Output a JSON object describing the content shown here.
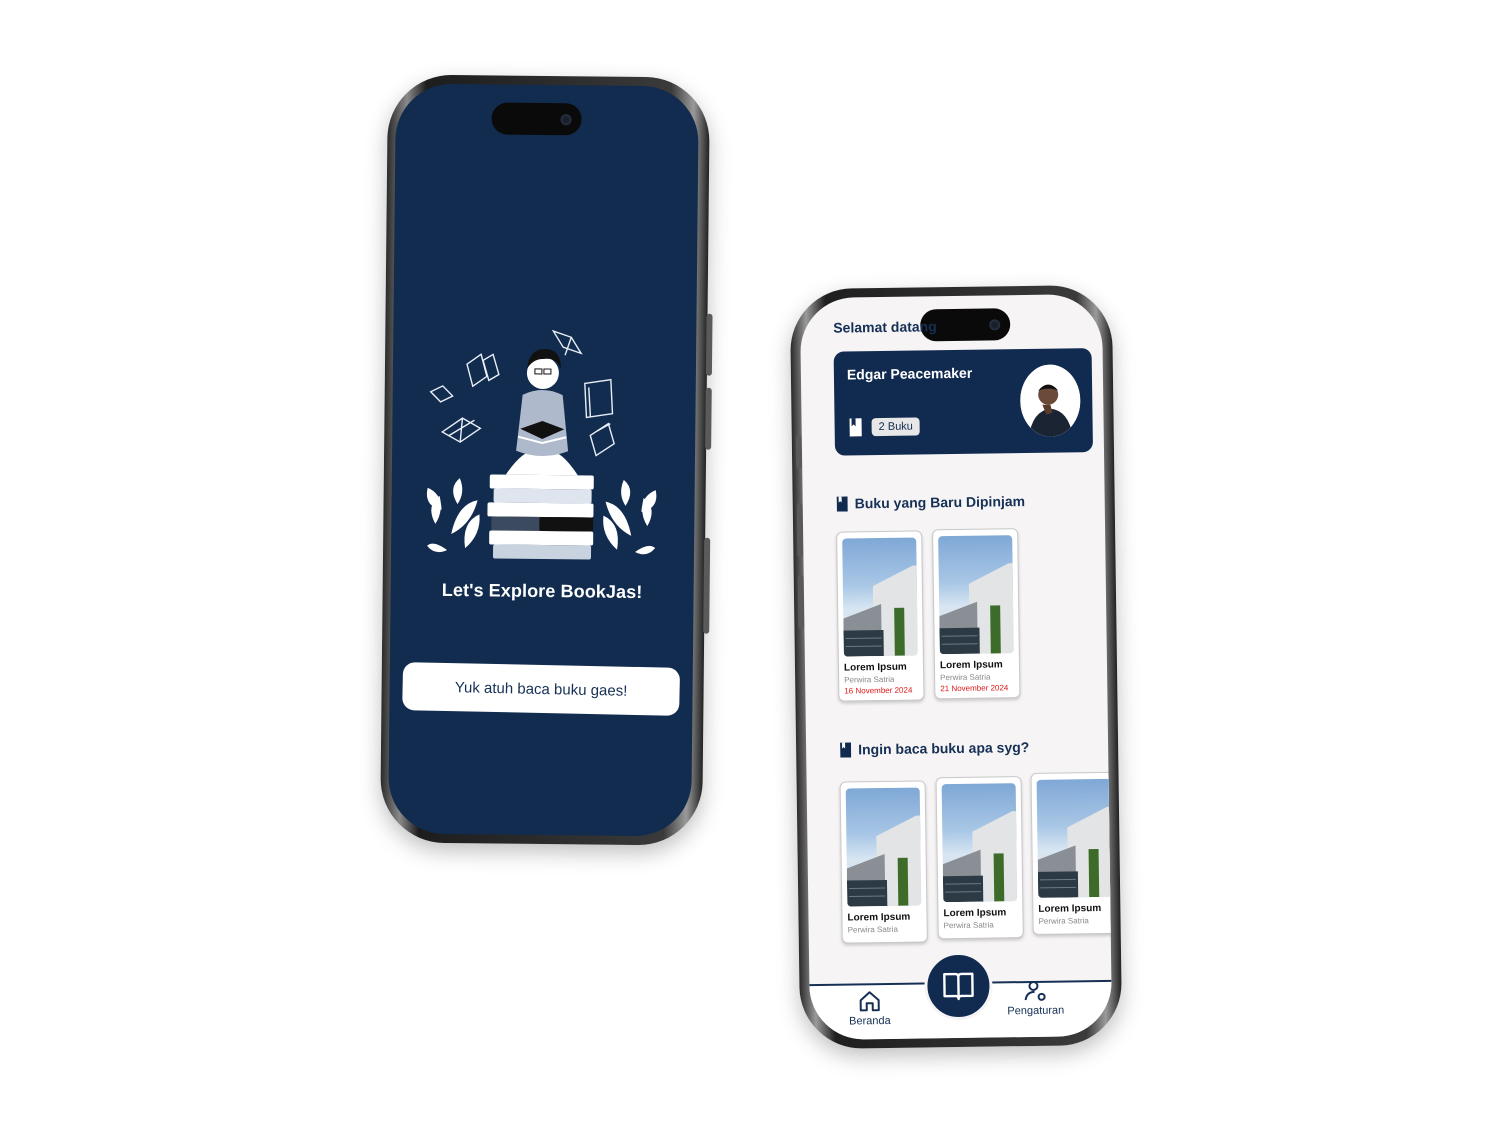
{
  "splash": {
    "title": "Let's Explore BookJas!",
    "start_button": "Yuk atuh baca buku gaes!"
  },
  "home": {
    "greeting": "Selamat datang",
    "profile": {
      "name": "Edgar Peacemaker",
      "book_count": "2 Buku"
    },
    "borrowed": {
      "title": "Buku yang Baru Dipinjam",
      "books": [
        {
          "title": "Lorem Ipsum",
          "author": "Perwira Satria",
          "date": "16 November 2024"
        },
        {
          "title": "Lorem Ipsum",
          "author": "Perwira Satria",
          "date": "21 November 2024"
        }
      ]
    },
    "recommend": {
      "title": "Ingin baca buku apa syg?",
      "books": [
        {
          "title": "Lorem Ipsum",
          "author": "Perwira Satria"
        },
        {
          "title": "Lorem Ipsum",
          "author": "Perwira Satria"
        },
        {
          "title": "Lorem Ipsum",
          "author": "Perwira Satria"
        }
      ]
    },
    "nav": {
      "home": "Beranda",
      "settings": "Pengaturan"
    }
  },
  "colors": {
    "primary": "#112b50",
    "date_red": "#e01919",
    "background": "#f6f4f5"
  },
  "icons": [
    "book-icon",
    "home-icon",
    "open-book-icon",
    "user-settings-icon"
  ]
}
